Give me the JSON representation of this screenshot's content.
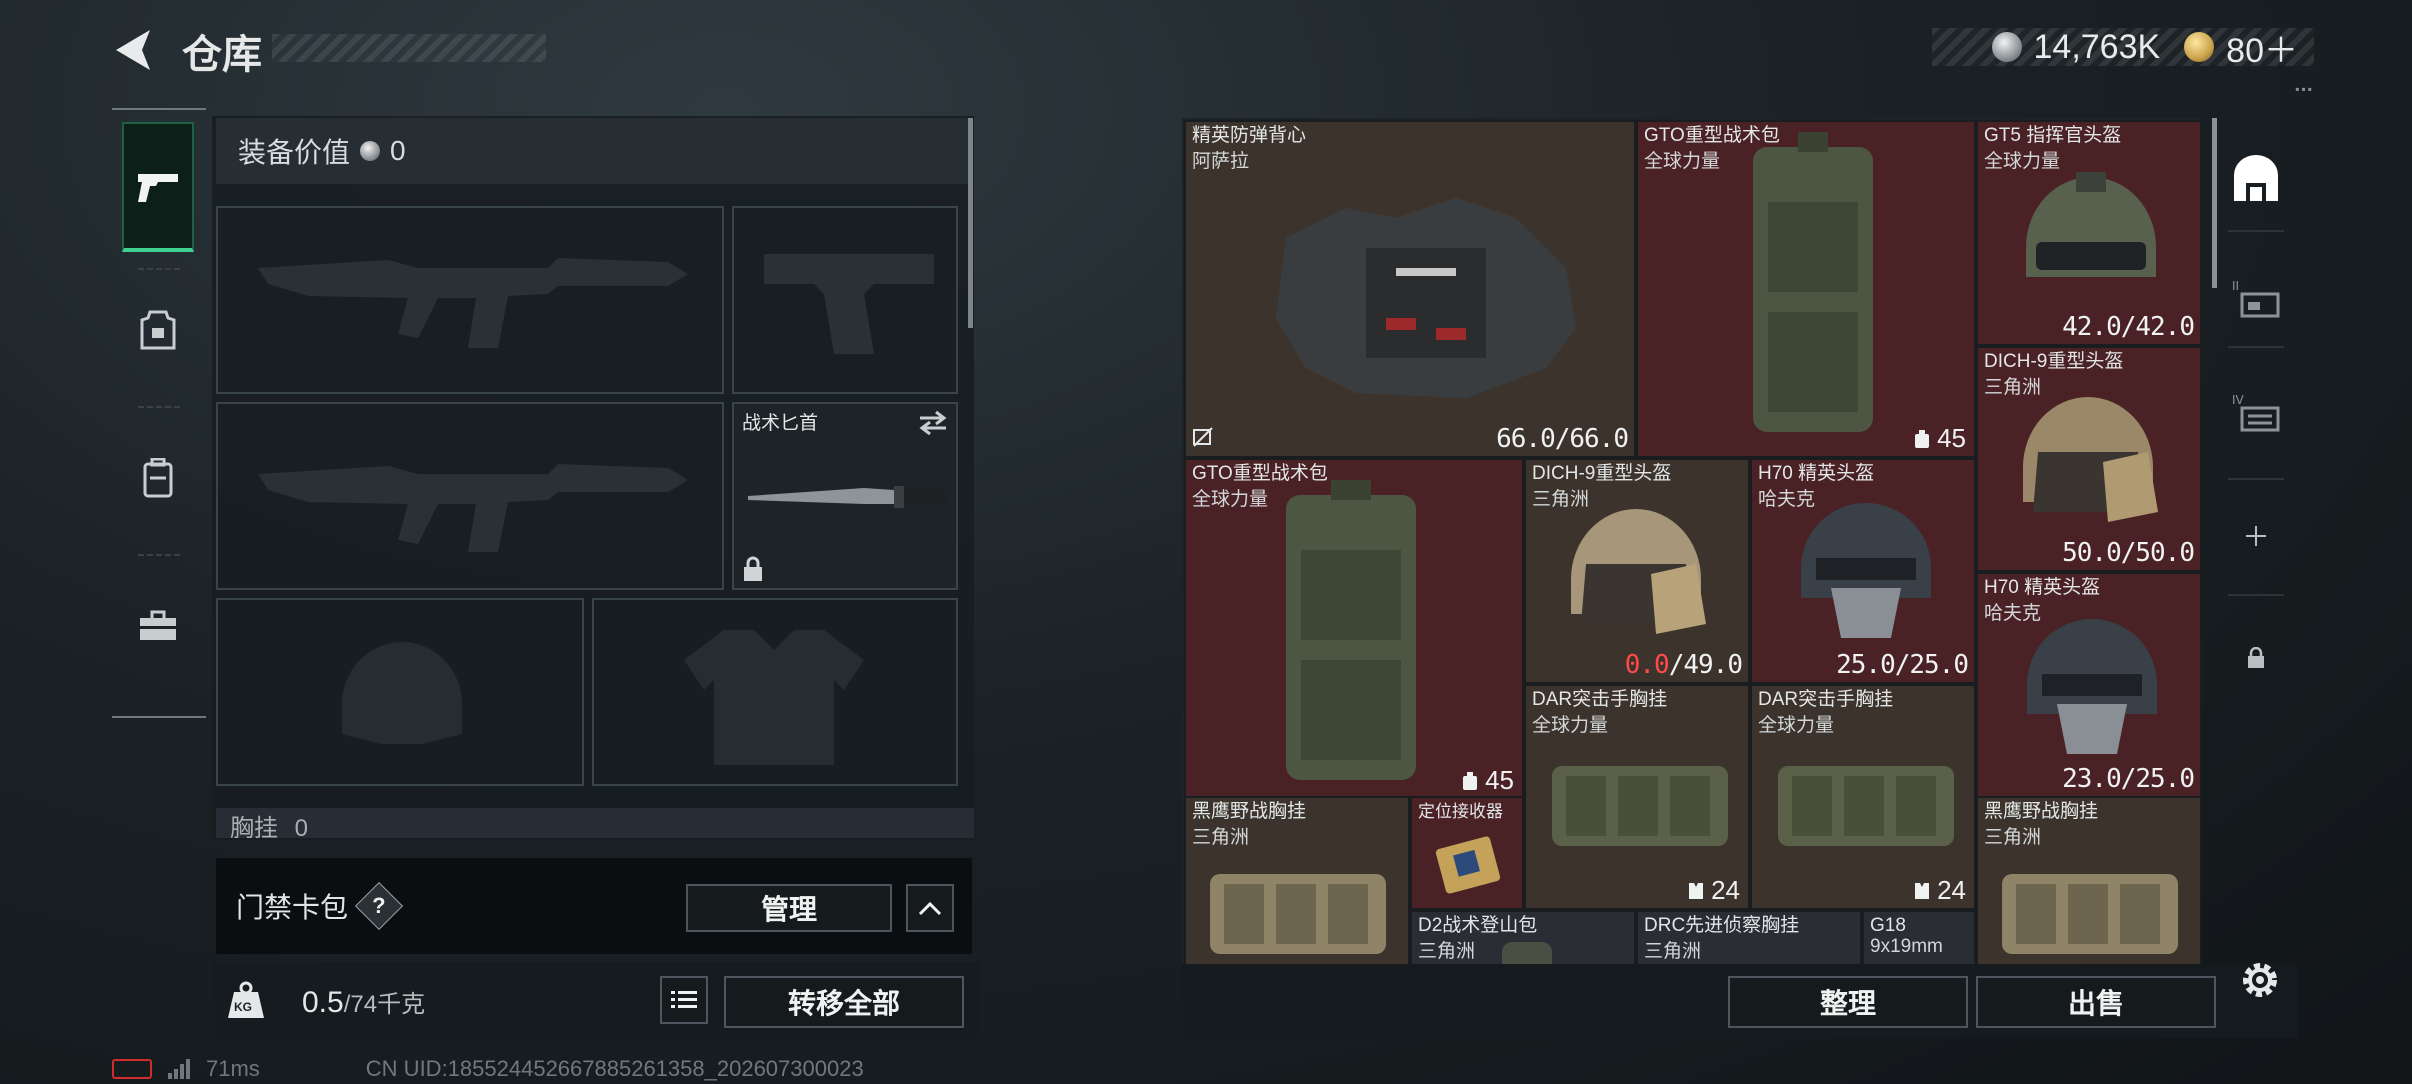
{
  "header": {
    "title": "仓库",
    "currency_amount": "14,763K",
    "tokens": "80＋"
  },
  "rail": {
    "items": [
      "pistol-icon",
      "armor-icon",
      "backpack-icon",
      "toolbox-icon"
    ]
  },
  "loadout": {
    "equip_value_label": "装备价值",
    "equip_value": "0",
    "knife_name": "战术匕首",
    "partial_label": "胸挂",
    "partial_count": "0"
  },
  "access_card": {
    "label": "门禁卡包",
    "help": "?",
    "manage_label": "管理"
  },
  "weight": {
    "current": "0.5",
    "max_text": "/74千克",
    "icon_text": "KG",
    "transfer_label": "转移全部"
  },
  "storage": {
    "items": [
      {
        "name": "精英防弹背心",
        "sub": "阿萨拉",
        "value": "66.0/66.0"
      },
      {
        "name": "GTO重型战术包",
        "sub": "全球力量",
        "value": "45"
      },
      {
        "name": "GT5 指挥官头盔",
        "sub": "全球力量",
        "value": "42.0/42.0"
      },
      {
        "name": "DICH-9重型头盔",
        "sub": "三角洲",
        "value": "50.0/50.0"
      },
      {
        "name": "GTO重型战术包",
        "sub": "全球力量",
        "value": "45"
      },
      {
        "name": "DICH-9重型头盔",
        "sub": "三角洲",
        "value_low": "0.0",
        "value_rest": "/49.0"
      },
      {
        "name": "H70 精英头盔",
        "sub": "哈夫克",
        "value": "25.0/25.0"
      },
      {
        "name": "H70 精英头盔",
        "sub": "哈夫克",
        "value": "23.0/25.0"
      },
      {
        "name": "DAR突击手胸挂",
        "sub": "全球力量",
        "value": "24"
      },
      {
        "name": "DAR突击手胸挂",
        "sub": "全球力量",
        "value": "24"
      },
      {
        "name": "黑鹰野战胸挂",
        "sub": "三角洲"
      },
      {
        "name": "定位接收器"
      },
      {
        "name": "黑鹰野战胸挂",
        "sub": "三角洲"
      },
      {
        "name": "D2战术登山包",
        "sub": "三角洲"
      },
      {
        "name": "DRC先进侦察胸挂",
        "sub": "三角洲"
      },
      {
        "name": "G18",
        "sub": "9x19mm"
      }
    ],
    "sort_label": "整理",
    "sell_label": "出售"
  },
  "status_bar": {
    "ping": "71ms",
    "uid": "CN UID:18552445266788526135​8_202607300023"
  },
  "colors": {
    "accent_green": "#3fd28f",
    "item_red": "#4a2226",
    "item_brown": "#3c342c",
    "low_durability": "#ff4a4a"
  }
}
